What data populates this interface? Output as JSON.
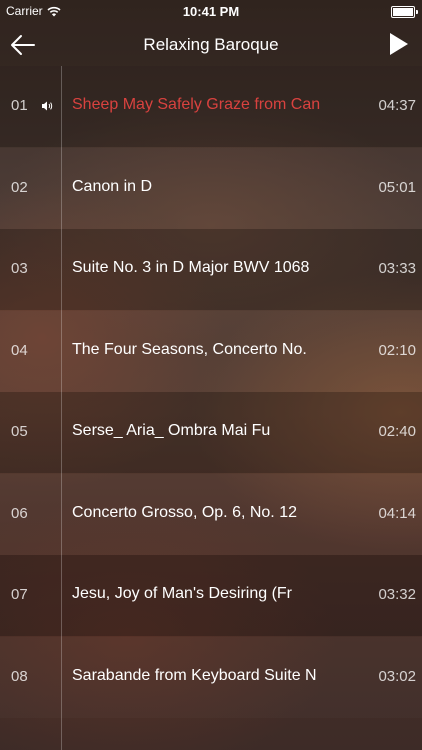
{
  "status_bar": {
    "carrier": "Carrier",
    "time": "10:41 PM"
  },
  "nav": {
    "title": "Relaxing Baroque"
  },
  "colors": {
    "now_playing": "#d9423f"
  },
  "tracks": [
    {
      "number": "01",
      "title": "Sheep May Safely Graze from Can",
      "duration": "04:37",
      "playing": true
    },
    {
      "number": "02",
      "title": "Canon in D",
      "duration": "05:01"
    },
    {
      "number": "03",
      "title": "Suite No. 3 in D Major BWV 1068",
      "duration": "03:33"
    },
    {
      "number": "04",
      "title": "The Four Seasons, Concerto No.",
      "duration": "02:10"
    },
    {
      "number": "05",
      "title": "Serse_ Aria_ Ombra Mai Fu",
      "duration": "02:40"
    },
    {
      "number": "06",
      "title": "Concerto Grosso, Op. 6, No. 12",
      "duration": "04:14"
    },
    {
      "number": "07",
      "title": "Jesu, Joy of Man's Desiring (Fr",
      "duration": "03:32"
    },
    {
      "number": "08",
      "title": "Sarabande from Keyboard Suite N",
      "duration": "03:02"
    }
  ]
}
